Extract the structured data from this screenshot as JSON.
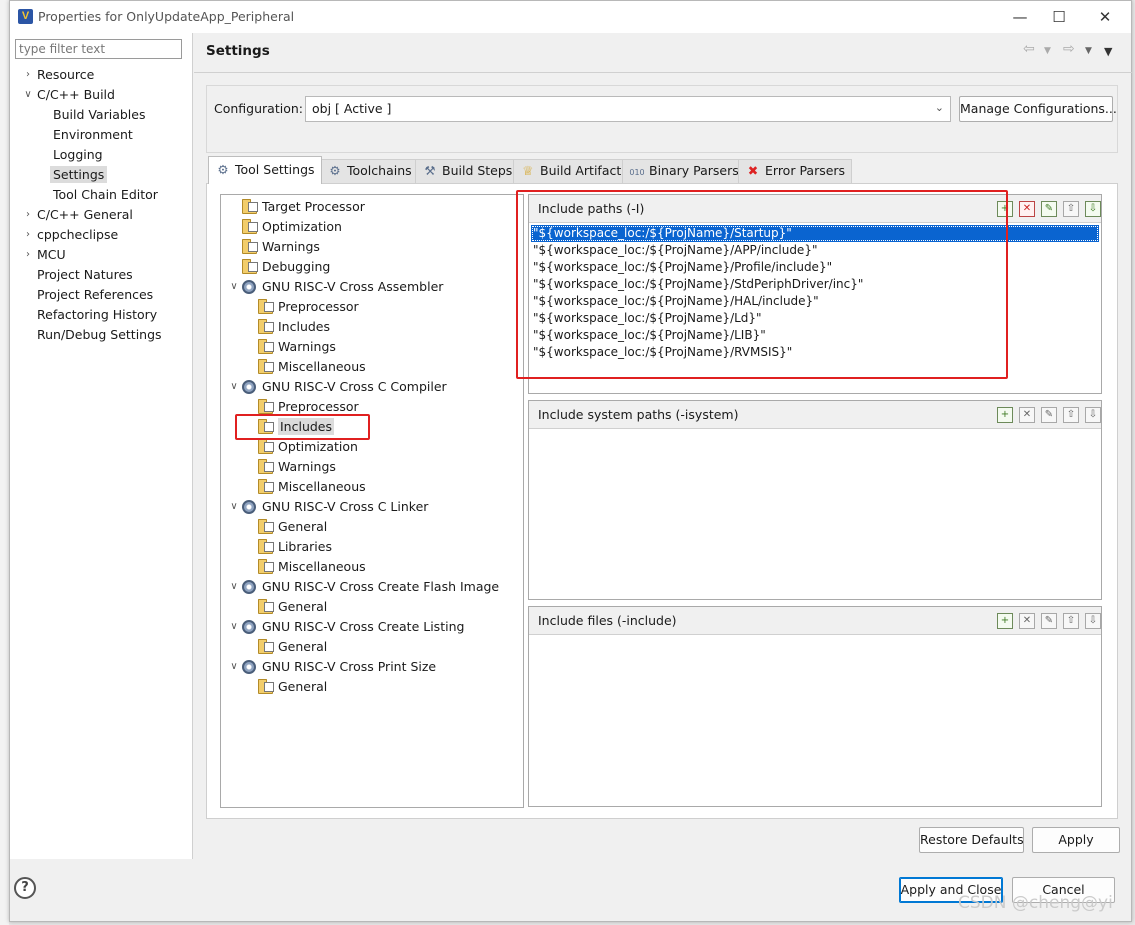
{
  "window": {
    "title": "Properties for OnlyUpdateApp_Peripheral",
    "controls": [
      "minimize",
      "maximize",
      "close"
    ]
  },
  "filter": {
    "placeholder": "type filter text"
  },
  "nav": [
    {
      "label": "Resource",
      "expander": "collapsed"
    },
    {
      "label": "C/C++ Build",
      "expander": "expanded"
    },
    {
      "label": "Build Variables"
    },
    {
      "label": "Environment"
    },
    {
      "label": "Logging"
    },
    {
      "label": "Settings",
      "selected": true
    },
    {
      "label": "Tool Chain Editor"
    },
    {
      "label": "C/C++ General",
      "expander": "collapsed"
    },
    {
      "label": "cppcheclipse",
      "expander": "collapsed"
    },
    {
      "label": "MCU",
      "expander": "collapsed"
    },
    {
      "label": "Project Natures"
    },
    {
      "label": "Project References"
    },
    {
      "label": "Refactoring History"
    },
    {
      "label": "Run/Debug Settings"
    }
  ],
  "header": {
    "title": "Settings"
  },
  "configuration": {
    "label": "Configuration:",
    "value": "obj  [ Active ]",
    "manage_button": "Manage Configurations..."
  },
  "tabs": [
    {
      "label": "Tool Settings",
      "icon": "gear-icon",
      "active": true
    },
    {
      "label": "Toolchains",
      "icon": "gear-icon"
    },
    {
      "label": "Build Steps",
      "icon": "hammer-icon"
    },
    {
      "label": "Build Artifact",
      "icon": "trophy-icon"
    },
    {
      "label": "Binary Parsers",
      "icon": "binary-icon"
    },
    {
      "label": "Error Parsers",
      "icon": "error-icon"
    }
  ],
  "tool_tree": [
    {
      "label": "Target Processor",
      "level": 0,
      "icon": "folder"
    },
    {
      "label": "Optimization",
      "level": 0,
      "icon": "folder"
    },
    {
      "label": "Warnings",
      "level": 0,
      "icon": "folder"
    },
    {
      "label": "Debugging",
      "level": 0,
      "icon": "folder"
    },
    {
      "label": "GNU RISC-V Cross Assembler",
      "level": 0,
      "icon": "gear",
      "expander": true
    },
    {
      "label": "Preprocessor",
      "level": 1,
      "icon": "folder"
    },
    {
      "label": "Includes",
      "level": 1,
      "icon": "folder"
    },
    {
      "label": "Warnings",
      "level": 1,
      "icon": "folder"
    },
    {
      "label": "Miscellaneous",
      "level": 1,
      "icon": "folder"
    },
    {
      "label": "GNU RISC-V Cross C Compiler",
      "level": 0,
      "icon": "gear",
      "expander": true
    },
    {
      "label": "Preprocessor",
      "level": 1,
      "icon": "folder"
    },
    {
      "label": "Includes",
      "level": 1,
      "icon": "folder",
      "selected": true
    },
    {
      "label": "Optimization",
      "level": 1,
      "icon": "folder"
    },
    {
      "label": "Warnings",
      "level": 1,
      "icon": "folder"
    },
    {
      "label": "Miscellaneous",
      "level": 1,
      "icon": "folder"
    },
    {
      "label": "GNU RISC-V Cross C Linker",
      "level": 0,
      "icon": "gear",
      "expander": true
    },
    {
      "label": "General",
      "level": 1,
      "icon": "folder"
    },
    {
      "label": "Libraries",
      "level": 1,
      "icon": "folder"
    },
    {
      "label": "Miscellaneous",
      "level": 1,
      "icon": "folder"
    },
    {
      "label": "GNU RISC-V Cross Create Flash Image",
      "level": 0,
      "icon": "gear",
      "expander": true
    },
    {
      "label": "General",
      "level": 1,
      "icon": "folder"
    },
    {
      "label": "GNU RISC-V Cross Create Listing",
      "level": 0,
      "icon": "gear",
      "expander": true
    },
    {
      "label": "General",
      "level": 1,
      "icon": "folder"
    },
    {
      "label": "GNU RISC-V Cross Print Size",
      "level": 0,
      "icon": "gear",
      "expander": true
    },
    {
      "label": "General",
      "level": 1,
      "icon": "folder"
    }
  ],
  "include_paths": {
    "title": "Include paths (-I)",
    "items": [
      "\"${workspace_loc:/${ProjName}/Startup}\"",
      "\"${workspace_loc:/${ProjName}/APP/include}\"",
      "\"${workspace_loc:/${ProjName}/Profile/include}\"",
      "\"${workspace_loc:/${ProjName}/StdPeriphDriver/inc}\"",
      "\"${workspace_loc:/${ProjName}/HAL/include}\"",
      "\"${workspace_loc:/${ProjName}/Ld}\"",
      "\"${workspace_loc:/${ProjName}/LIB}\"",
      "\"${workspace_loc:/${ProjName}/RVMSIS}\""
    ],
    "selected_index": 0
  },
  "include_system_paths": {
    "title": "Include system paths (-isystem)",
    "items": []
  },
  "include_files": {
    "title": "Include files (-include)",
    "items": []
  },
  "buttons": {
    "restore_defaults": "Restore Defaults",
    "apply": "Apply",
    "apply_and_close": "Apply and Close",
    "cancel": "Cancel",
    "help": "?"
  },
  "watermark": "CSDN @cheng@yi",
  "colors": {
    "selection": "#0a64d0",
    "highlight": "#e02020"
  }
}
